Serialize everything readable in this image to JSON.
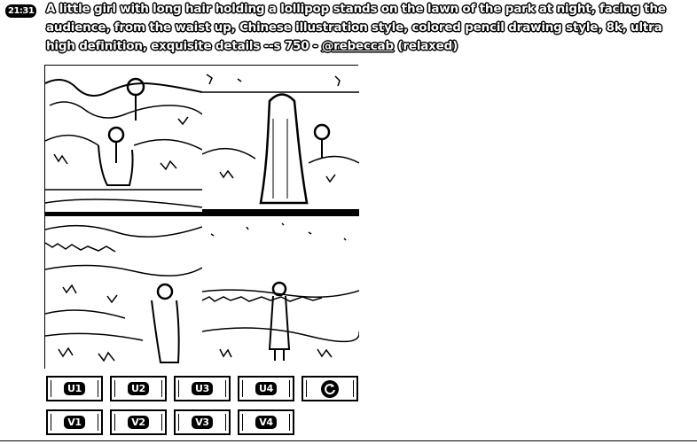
{
  "message": {
    "timestamp": "21:31",
    "prompt_text": "A little girl with long hair holding a lollipop stands on the lawn of the park at night, facing the audience, from the waist up, Chinese illustration style, colored pencil drawing style, 8k, ultra high definition, exquisite details --s 750 - ",
    "mention": "@rebeccab",
    "mode": " (relaxed)"
  },
  "image_grid": {
    "tiles": [
      "upscale-1",
      "upscale-2",
      "upscale-3",
      "upscale-4"
    ]
  },
  "buttons": {
    "upscale": [
      "U1",
      "U2",
      "U3",
      "U4"
    ],
    "variation": [
      "V1",
      "V2",
      "V3",
      "V4"
    ],
    "reroll_icon": "refresh-icon"
  }
}
